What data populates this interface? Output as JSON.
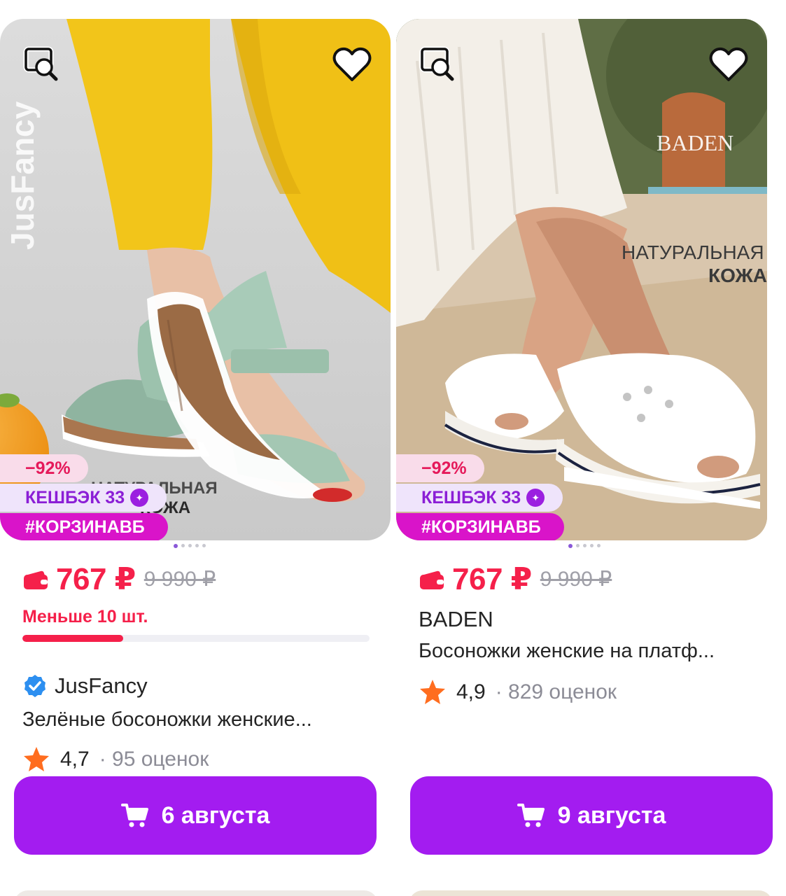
{
  "products": [
    {
      "photo": {
        "brand_watermark": "JusFancy",
        "overlay_text": [
          "НАТУРАЛЬНАЯ",
          "КОЖА"
        ]
      },
      "badges": {
        "discount": "−92%",
        "cashback": "КЕШБЭК 33",
        "tag": "#КОРЗИНАВБ"
      },
      "gallery_dots": 5,
      "gallery_active": 0,
      "price": "767 ₽",
      "old_price": "9 990 ₽",
      "stock_text": "Меньше 10 шт.",
      "stock_level": 0.29,
      "brand": "JusFancy",
      "brand_verified": true,
      "title": "Зелёные босоножки женские...",
      "rating": "4,7",
      "reviews": "95 оценок",
      "delivery": "6 августа"
    },
    {
      "photo": {
        "brand_watermark": "BADEN",
        "overlay_text": [
          "НАТУРАЛЬНАЯ",
          "КОЖА"
        ]
      },
      "badges": {
        "discount": "−92%",
        "cashback": "КЕШБЭК 33",
        "tag": "#КОРЗИНАВБ"
      },
      "gallery_dots": 5,
      "gallery_active": 0,
      "price": "767 ₽",
      "old_price": "9 990 ₽",
      "brand": "BADEN",
      "title": "Босоножки женские на платф...",
      "rating": "4,9",
      "reviews": "829 оценок",
      "delivery": "9 августа"
    }
  ],
  "icons": {
    "search": "image-search-icon",
    "favorite": "heart-outline-icon",
    "wallet": "wallet-icon",
    "verified": "verified-check-icon",
    "star": "star-icon",
    "cart": "cart-icon"
  },
  "colors": {
    "accent": "#a31cf0",
    "price": "#f5204a",
    "tag": "#d914c9",
    "cashback_text": "#8b1ed6",
    "star": "#ff6d1f",
    "verified": "#2d8ff0"
  }
}
